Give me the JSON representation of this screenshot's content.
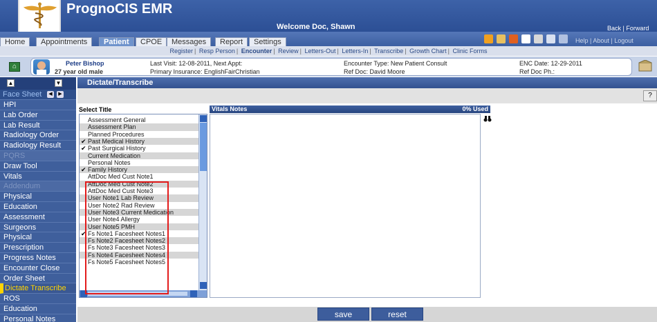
{
  "header": {
    "app_title": "PrognoCIS EMR",
    "welcome": "Welcome Doc, Shawn",
    "back_link": "Back | Forward",
    "right_links": "Help | About | Logout"
  },
  "tabs": [
    {
      "label": "Home"
    },
    {
      "label": "Appointments"
    },
    {
      "label": "Patient"
    },
    {
      "label": "CPOE"
    },
    {
      "label": "Messages"
    },
    {
      "label": "Report"
    },
    {
      "label": "Settings"
    }
  ],
  "subnav": [
    "Register",
    "Resp Person",
    "Encounter",
    "Review",
    "Letters-Out",
    "Letters-In",
    "Transcribe",
    "Growth Chart",
    "Clinic Forms"
  ],
  "patient": {
    "name": "Peter Bishop",
    "age": "27 year old male",
    "last_visit": "Last Visit: 12-08-2011, Next Appt:",
    "insurance": "Primary Insurance: EnglishFairChristian",
    "enc_type": "Encounter Type: New Patient Consult",
    "ref_doc": "Ref Doc: David Moore",
    "enc_date": "ENC Date: 12-29-2011",
    "ref_ph": "Ref Doc Ph.:"
  },
  "sidebar": {
    "face_sheet": "Face Sheet",
    "items": [
      {
        "label": "HPI"
      },
      {
        "label": "Lab Order"
      },
      {
        "label": "Lab Result"
      },
      {
        "label": "Radiology Order"
      },
      {
        "label": "Radiology Result"
      },
      {
        "label": "PQRS",
        "disabled": true
      },
      {
        "label": "Draw Tool"
      },
      {
        "label": "Vitals"
      },
      {
        "label": "Addendum",
        "disabled": true
      },
      {
        "label": "Physical"
      },
      {
        "label": "Education"
      },
      {
        "label": "Assessment"
      },
      {
        "label": "Surgeons"
      },
      {
        "label": "Physical"
      },
      {
        "label": "Prescription"
      },
      {
        "label": "Progress Notes"
      },
      {
        "label": "Encounter Close"
      },
      {
        "label": "Order Sheet"
      },
      {
        "label": "Dictate Transcribe",
        "selected": true
      },
      {
        "label": "ROS"
      },
      {
        "label": "Education"
      },
      {
        "label": "Personal Notes"
      }
    ]
  },
  "main": {
    "section_title": "Dictate/Transcribe",
    "help_label": "?",
    "select_title_label": "Select Title",
    "notes_title": "Vitals Notes",
    "notes_used": "0% Used",
    "titles": [
      {
        "label": "Assessment General",
        "checked": false
      },
      {
        "label": "Assessment Plan",
        "checked": false
      },
      {
        "label": "Planned Procedures",
        "checked": false
      },
      {
        "label": "Past Medical History",
        "checked": true
      },
      {
        "label": "Past Surgical History",
        "checked": true
      },
      {
        "label": "Current Medication",
        "checked": false
      },
      {
        "label": "Personal Notes",
        "checked": false
      },
      {
        "label": "Family History",
        "checked": true
      },
      {
        "label": "AttDoc Med Cust Note1",
        "checked": false
      },
      {
        "label": "AttDoc Med Cust Note2",
        "checked": false
      },
      {
        "label": "AttDoc Med Cust Note3",
        "checked": false
      },
      {
        "label": "User Note1 Lab Review",
        "checked": false
      },
      {
        "label": "User Note2 Rad Review",
        "checked": false
      },
      {
        "label": "User Note3 Current Medication",
        "checked": false
      },
      {
        "label": "User Note4 Allergy",
        "checked": false
      },
      {
        "label": "User Note5 PMH",
        "checked": false
      },
      {
        "label": "Fs Note1 Facesheet Notes1",
        "checked": true
      },
      {
        "label": "Fs Note2 Facesheet Notes2",
        "checked": false
      },
      {
        "label": "Fs Note3 Facesheet Notes3",
        "checked": false
      },
      {
        "label": "Fs Note4 Facesheet Notes4",
        "checked": false
      },
      {
        "label": "Fs Note5 Facesheet Notes5",
        "checked": false
      }
    ]
  },
  "footer": {
    "save_label": "save",
    "reset_label": "reset"
  },
  "colors": {
    "header_blue": "#2c4f95",
    "sidebar_blue": "#3f5f9c",
    "selected_yellow": "#ffd400",
    "highlight_red": "#e31b1b"
  }
}
